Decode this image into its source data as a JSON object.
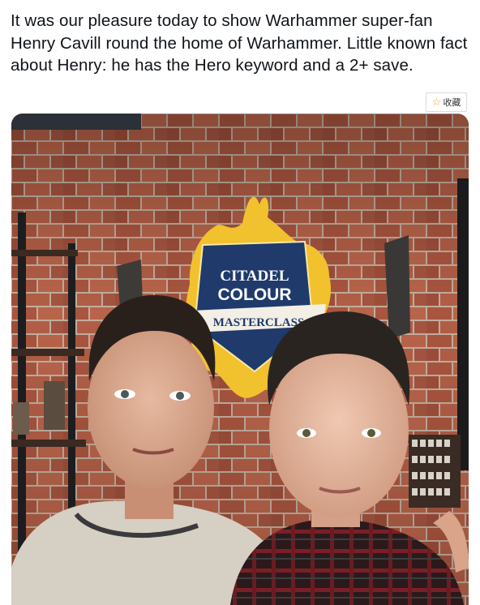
{
  "post": {
    "text": "It was our pleasure today to show Warhammer super-fan Henry Cavill round the home of Warhammer. Little known fact about Henry: he has the Hero keyword and a 2+ save."
  },
  "actions": {
    "collect_icon": "star-outline-icon",
    "collect_label": "收藏"
  },
  "photo": {
    "sign": {
      "line1": "CITADEL",
      "line2": "COLOUR",
      "line3": "MASTERCLASS"
    }
  },
  "colors": {
    "text": "#0f1419",
    "brick": "#a85a43",
    "mortar": "#c9b6a6",
    "sign_navy": "#1f3a6b",
    "sign_gold": "#f2c12e"
  }
}
